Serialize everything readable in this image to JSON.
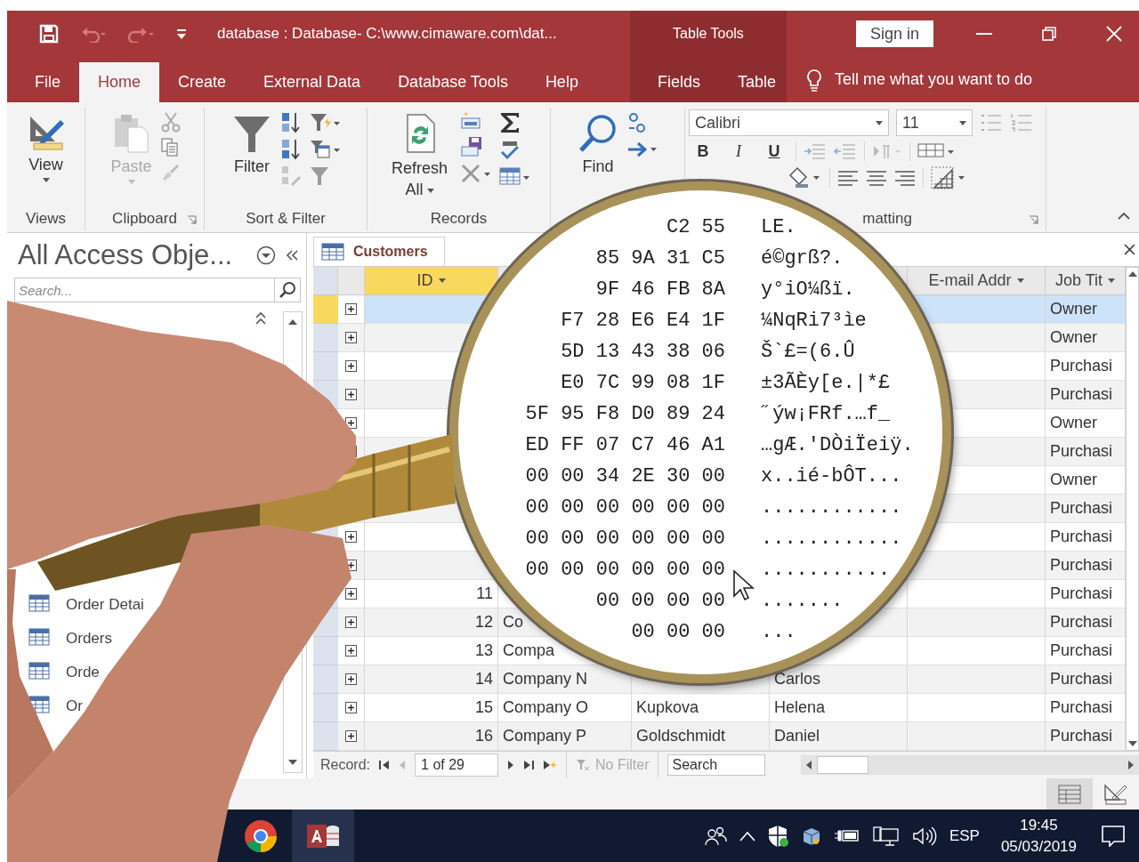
{
  "window": {
    "title": "database : Database- C:\\www.cimaware.com\\dat...",
    "context_title": "Table Tools",
    "sign_in": "Sign in"
  },
  "quick_access": [
    {
      "kind": "save",
      "disabled": false
    },
    {
      "kind": "undo",
      "disabled": true
    },
    {
      "kind": "redo",
      "disabled": true
    },
    {
      "kind": "customize",
      "disabled": false
    }
  ],
  "tabs": [
    {
      "label": "File",
      "selected": false,
      "contextual": false
    },
    {
      "label": "Home",
      "selected": true,
      "contextual": false
    },
    {
      "label": "Create",
      "selected": false,
      "contextual": false
    },
    {
      "label": "External Data",
      "selected": false,
      "contextual": false
    },
    {
      "label": "Database Tools",
      "selected": false,
      "contextual": false
    },
    {
      "label": "Help",
      "selected": false,
      "contextual": false
    },
    {
      "label": "Fields",
      "selected": false,
      "contextual": true
    },
    {
      "label": "Table",
      "selected": false,
      "contextual": true
    }
  ],
  "tell_me": "Tell me what you want to do",
  "ribbon": {
    "groups": [
      {
        "kind": "views",
        "label": "Views",
        "button": {
          "label": "View",
          "disabled": false
        }
      },
      {
        "kind": "clipboard",
        "label": "Clipboard",
        "button": {
          "label": "Paste",
          "disabled": true
        }
      },
      {
        "kind": "sort_filter",
        "label": "Sort & Filter",
        "button": {
          "label": "Filter",
          "disabled": false
        }
      },
      {
        "kind": "records",
        "label": "Records",
        "button": {
          "label": "Refresh All",
          "disabled": false
        }
      },
      {
        "kind": "find",
        "button": {
          "label": "Find",
          "disabled": false
        }
      },
      {
        "kind": "text_formatting",
        "label": "matting",
        "font": "Calibri",
        "size": "11",
        "format_buttons": [
          {
            "kind": "bold",
            "label": "B"
          },
          {
            "kind": "italic",
            "label": "I"
          },
          {
            "kind": "underline",
            "label": "U"
          }
        ]
      }
    ]
  },
  "navigation_pane": {
    "title": "All Access Obje...",
    "search_placeholder": "Search...",
    "items": [
      {
        "label": "Order Detai"
      },
      {
        "label": "Orders"
      },
      {
        "label": "Orde"
      },
      {
        "label": "Or"
      }
    ]
  },
  "document": {
    "tab": "Customers",
    "columns": [
      {
        "label": "ID",
        "kind": "number",
        "selected": true
      },
      {
        "kind": "text"
      },
      {
        "kind": "text"
      },
      {
        "kind": "text"
      },
      {
        "label": "E-mail Addr",
        "kind": "text",
        "selected": false
      },
      {
        "label": "Job Tit",
        "kind": "text",
        "selected": false
      }
    ],
    "rows": [
      {
        "selected": true,
        "cells": {
          "column_6": "Owner"
        }
      },
      {
        "selected": false,
        "cells": {
          "column_6": "Owner"
        }
      },
      {
        "selected": false,
        "cells": {
          "column_6": "Purchasi"
        }
      },
      {
        "selected": false,
        "cells": {
          "column_6": "Purchasi"
        }
      },
      {
        "selected": false,
        "cells": {
          "column_6": "Owner"
        }
      },
      {
        "selected": false,
        "cells": {
          "column_6": "Purchasi"
        }
      },
      {
        "selected": false,
        "cells": {
          "column_6": "Owner"
        }
      },
      {
        "selected": false,
        "cells": {
          "column_6": "Purchasi"
        }
      },
      {
        "selected": false,
        "cells": {
          "column_6": "Purchasi"
        }
      },
      {
        "selected": false,
        "cells": {
          "column_6": "Purchasi"
        }
      },
      {
        "selected": false,
        "cells": {
          "column_1": "11",
          "column_6": "Purchasi"
        }
      },
      {
        "selected": false,
        "cells": {
          "column_1": "12",
          "column_2": "Co",
          "column_6": "Purchasi"
        }
      },
      {
        "selected": false,
        "cells": {
          "column_1": "13",
          "column_2": "Compa",
          "column_6": "Purchasi"
        }
      },
      {
        "selected": false,
        "cells": {
          "column_1": "14",
          "column_2": "Company N",
          "column_4": "Carlos",
          "column_6": "Purchasi"
        }
      },
      {
        "selected": false,
        "cells": {
          "column_1": "15",
          "column_2": "Company O",
          "column_3": "Kupkova",
          "column_4": "Helena",
          "column_6": "Purchasi"
        }
      },
      {
        "selected": false,
        "cells": {
          "column_1": "16",
          "column_2": "Company P",
          "column_3": "Goldschmidt",
          "column_4": "Daniel",
          "column_6": "Purchasi"
        }
      }
    ],
    "record_navigator": {
      "label": "Record:",
      "position": "1 of 29",
      "filter": "No Filter",
      "filter_disabled": true,
      "search_placeholder": "Search"
    }
  },
  "lens": {
    "rows": [
      {
        "hex": "C2 55",
        "text": "LE."
      },
      {
        "hex": "85 9A 31 C5",
        "text": "é©grß?."
      },
      {
        "hex": "9F 46 FB 8A",
        "text": "y°iO¼ßï."
      },
      {
        "hex": "F7 28 E6 E4 1F",
        "text": "¼NqRi7³ìe"
      },
      {
        "hex": "5D 13 43 38 06",
        "text": "Š`£=(6.Û"
      },
      {
        "hex": "E0 7C 99 08 1F",
        "text": "±3ÃÈy[e.|*£"
      },
      {
        "hex": "5F 95 F8 D0 89 24",
        "text": "˝ýw¡FRf.…f_"
      },
      {
        "hex": "ED FF 07 C7 46 A1",
        "text": "…gÆ.'DÒiÏeiÿ."
      },
      {
        "hex": "00 00 34 2E 30 00",
        "text": "x..ié-bÔT..."
      },
      {
        "hex": "00 00 00 00 00 00",
        "text": "............"
      },
      {
        "hex": "00 00 00 00 00 00",
        "text": "............"
      },
      {
        "hex": "00 00 00 00 00 00",
        "text": "..........."
      },
      {
        "hex": "00 00 00 00",
        "text": "......."
      },
      {
        "hex": "00 00 00",
        "text": "..."
      }
    ]
  },
  "taskbar": {
    "apps": [
      {
        "kind": "chrome",
        "active": false
      },
      {
        "kind": "access",
        "active": true
      }
    ],
    "language": "ESP",
    "time": "19:45",
    "date": "05/03/2019"
  }
}
